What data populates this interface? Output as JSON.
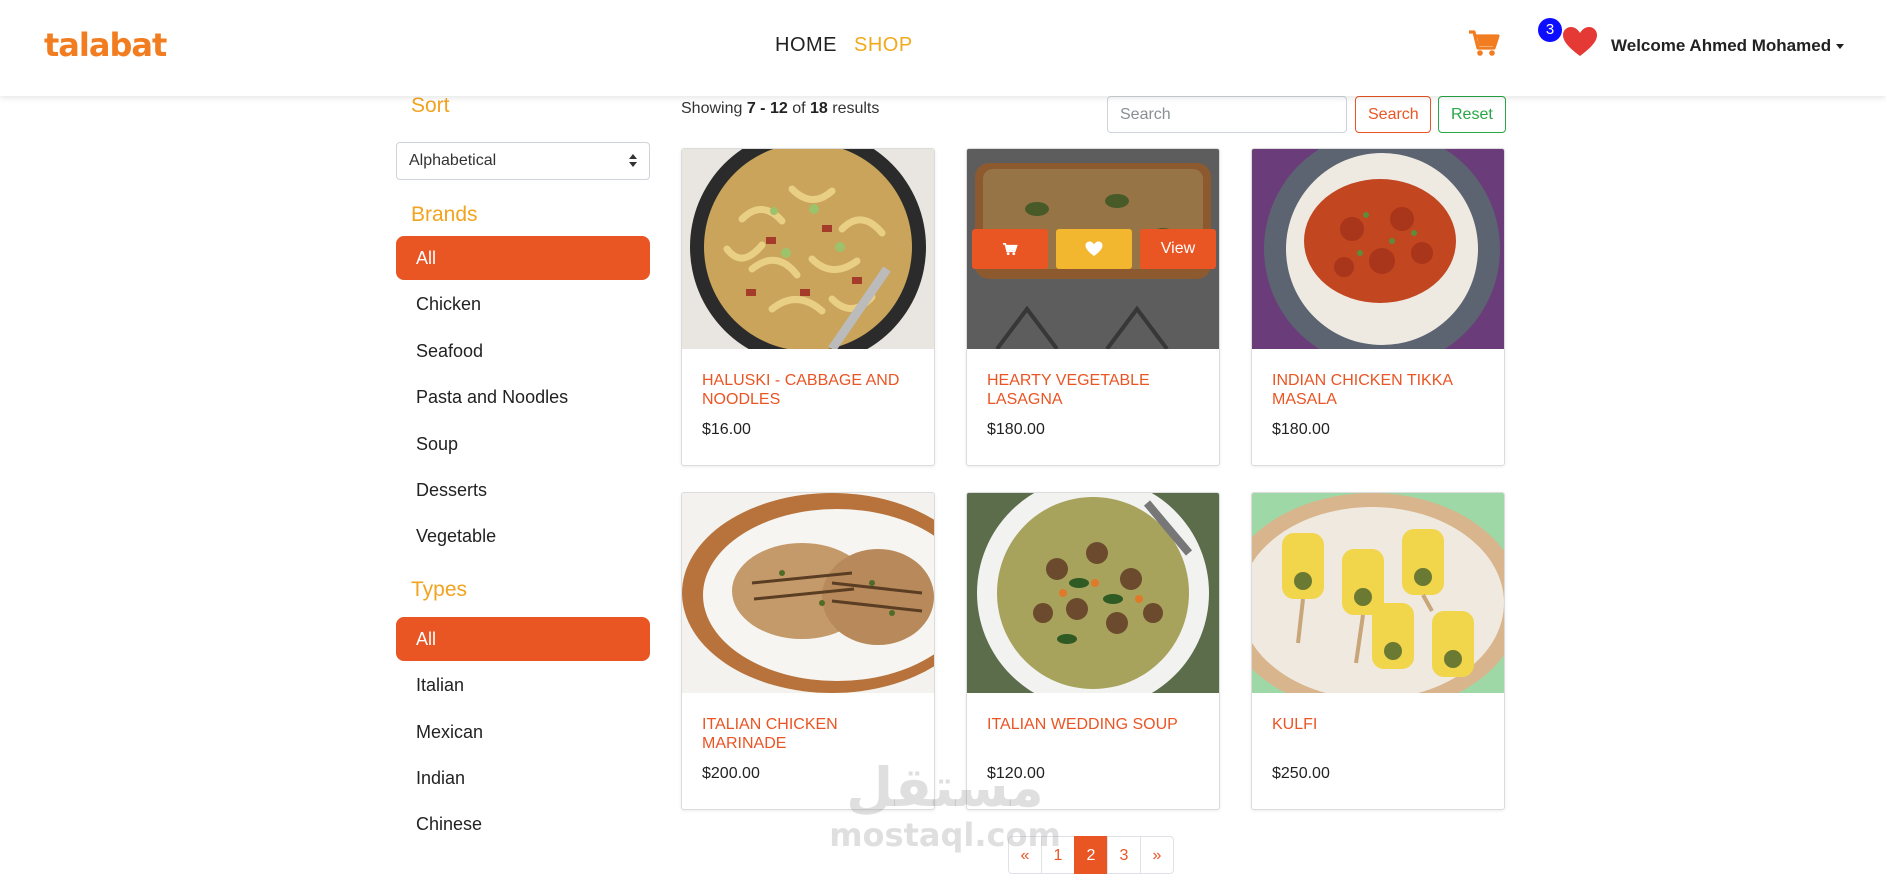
{
  "nav": {
    "logo": "talabat",
    "links": [
      "HOME",
      "SHOP"
    ],
    "active_link": "SHOP",
    "wishlist_count": "3",
    "user_label": "Welcome Ahmed Mohamed"
  },
  "sidebar": {
    "sort_heading": "Sort",
    "sort_value": "Alphabetical",
    "brands_heading": "Brands",
    "brands": [
      "All",
      "Chicken",
      "Seafood",
      "Pasta and Noodles",
      "Soup",
      "Desserts",
      "Vegetable"
    ],
    "brands_selected": "All",
    "types_heading": "Types",
    "types": [
      "All",
      "Italian",
      "Mexican",
      "Indian",
      "Chinese"
    ],
    "types_selected": "All"
  },
  "toolbar": {
    "showing_prefix": "Showing",
    "range": "7 - 12",
    "of_word": "of",
    "total": "18",
    "results_word": "results",
    "search_placeholder": "Search",
    "search_label": "Search",
    "reset_label": "Reset"
  },
  "products": [
    {
      "name": "HALUSKI - CABBAGE AND NOODLES",
      "price": "$16.00"
    },
    {
      "name": "HEARTY VEGETABLE LASAGNA",
      "price": "$180.00"
    },
    {
      "name": "INDIAN CHICKEN TIKKA MASALA",
      "price": "$180.00"
    },
    {
      "name": "ITALIAN CHICKEN MARINADE",
      "price": "$200.00"
    },
    {
      "name": "ITALIAN WEDDING SOUP",
      "price": "$120.00"
    },
    {
      "name": "KULFI",
      "price": "$250.00"
    }
  ],
  "hover_actions": {
    "view_label": "View"
  },
  "pagination": {
    "prev": "«",
    "pages": [
      "1",
      "2",
      "3"
    ],
    "current": "2",
    "next": "»"
  },
  "watermark": {
    "arabic": "مستقل",
    "latin": "mostaql.com"
  },
  "colors": {
    "brand": "#f27d20",
    "accent": "#ea5524",
    "heading": "#f2a31f",
    "reset": "#28a745",
    "badge": "#0d0dff",
    "heart": "#e53935"
  }
}
